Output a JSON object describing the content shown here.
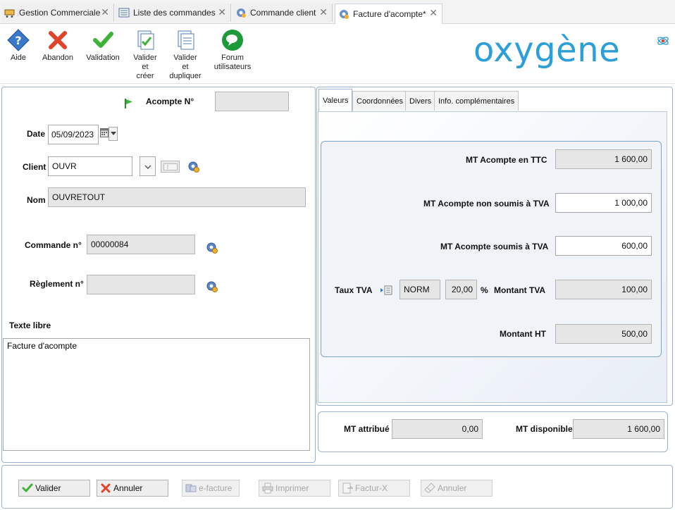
{
  "tabs": [
    {
      "label": "Gestion Commerciale"
    },
    {
      "label": "Liste des commandes"
    },
    {
      "label": "Commande client"
    },
    {
      "label": "Facture d'acompte*"
    }
  ],
  "toolbar": {
    "aide": "Aide",
    "abandon": "Abandon",
    "validation": "Validation",
    "valider_creer": [
      "Valider",
      "et",
      "créer"
    ],
    "valider_dupliquer": [
      "Valider",
      "et",
      "dupliquer"
    ],
    "forum": [
      "Forum",
      "utilisateurs"
    ]
  },
  "logo": {
    "text": "oxygène",
    "color": "#2a9fd9"
  },
  "form": {
    "acompte_label": "Acompte N°",
    "acompte_value": "",
    "date_label": "Date",
    "date_value": "05/09/2023",
    "client_label": "Client",
    "client_value": "OUVR",
    "nom_label": "Nom",
    "nom_value": "OUVRETOUT",
    "commande_label": "Commande n°",
    "commande_value": "00000084",
    "reglement_label": "Règlement n°",
    "reglement_value": "",
    "texte_libre_label": "Texte libre",
    "texte_libre_value": "Facture d'acompte"
  },
  "inner_tabs": [
    "Valeurs",
    "Coordonnées",
    "Divers",
    "Info. complémentaires"
  ],
  "values": {
    "mt_ttc_label": "MT Acompte en TTC",
    "mt_ttc_value": "1 600,00",
    "mt_non_soumis_label": "MT Acompte non soumis à TVA",
    "mt_non_soumis_value": "1 000,00",
    "mt_soumis_label": "MT Acompte soumis à TVA",
    "mt_soumis_value": "600,00",
    "taux_tva_label": "Taux TVA",
    "taux_code": "NORM",
    "taux_value": "20,00",
    "percent": "%",
    "montant_tva_label": "Montant TVA",
    "montant_tva_value": "100,00",
    "montant_ht_label": "Montant HT",
    "montant_ht_value": "500,00"
  },
  "totals": {
    "mt_attribue_label": "MT attribué",
    "mt_attribue_value": "0,00",
    "mt_disponible_label": "MT disponible",
    "mt_disponible_value": "1 600,00"
  },
  "footer": {
    "valider": "Valider",
    "annuler": "Annuler",
    "efacture": "e-facture",
    "imprimer": "Imprimer",
    "facturx": "Factur-X",
    "annuler2": "Annuler"
  },
  "colors": {
    "accent": "#2a9fd9",
    "green": "#3fb23a",
    "red": "#e0442b"
  }
}
